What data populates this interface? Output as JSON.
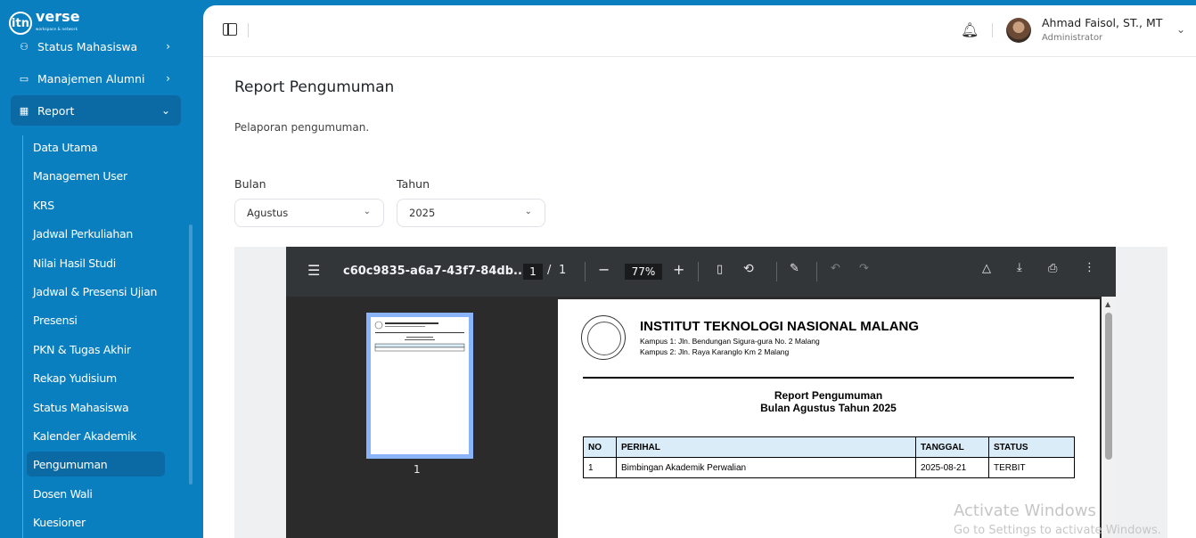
{
  "app": {
    "logo_mark": "itn",
    "logo_text": "verse",
    "logo_sub": "workspace & network"
  },
  "sidebar": {
    "top_items": [
      {
        "label": "Status Mahasiswa",
        "icon": "users-icon"
      },
      {
        "label": "Manajemen Alumni",
        "icon": "folder-icon"
      },
      {
        "label": "Report",
        "icon": "report-icon",
        "expanded": true
      }
    ],
    "sub_items": [
      {
        "label": "Data Utama"
      },
      {
        "label": "Managemen User"
      },
      {
        "label": "KRS"
      },
      {
        "label": "Jadwal Perkuliahan"
      },
      {
        "label": "Nilai Hasil Studi"
      },
      {
        "label": "Jadwal & Presensi Ujian"
      },
      {
        "label": "Presensi"
      },
      {
        "label": "PKN & Tugas Akhir"
      },
      {
        "label": "Rekap Yudisium"
      },
      {
        "label": "Status Mahasiswa"
      },
      {
        "label": "Kalender Akademik"
      },
      {
        "label": "Pengumuman",
        "active": true
      },
      {
        "label": "Dosen Wali"
      },
      {
        "label": "Kuesioner"
      }
    ]
  },
  "header": {
    "user_name": "Ahmad Faisol, ST., MT",
    "user_role": "Administrator"
  },
  "page": {
    "title": "Report Pengumuman",
    "description": "Pelaporan pengumuman."
  },
  "filters": {
    "bulan_label": "Bulan",
    "bulan_value": "Agustus",
    "tahun_label": "Tahun",
    "tahun_value": "2025"
  },
  "pdf_viewer": {
    "filename": "c60c9835-a6a7-43f7-84db...",
    "current_page": "1",
    "page_sep": "/",
    "total_pages": "1",
    "zoom": "77%",
    "thumbnail_label": "1"
  },
  "document": {
    "institution": "INSTITUT TEKNOLOGI NASIONAL MALANG",
    "address_1": "Kampus 1: Jln. Bendungan Sigura-gura No. 2 Malang",
    "address_2": "Kampus 2: Jln. Raya Karanglo Km 2 Malang",
    "title": "Report Pengumuman",
    "subtitle": "Bulan Agustus Tahun 2025",
    "table_headers": [
      "NO",
      "PERIHAL",
      "TANGGAL",
      "STATUS"
    ],
    "rows": [
      [
        "1",
        "Bimbingan Akademik Perwalian",
        "2025-08-21",
        "TERBIT"
      ]
    ]
  },
  "watermark": {
    "line1": "Activate Windows",
    "line2": "Go to Settings to activate Windows."
  },
  "colors": {
    "sidebar": "#0a7fc0",
    "sidebar_active": "#0b6aa3",
    "table_header": "#d9ecf7",
    "pdf_toolbar": "#333639"
  }
}
